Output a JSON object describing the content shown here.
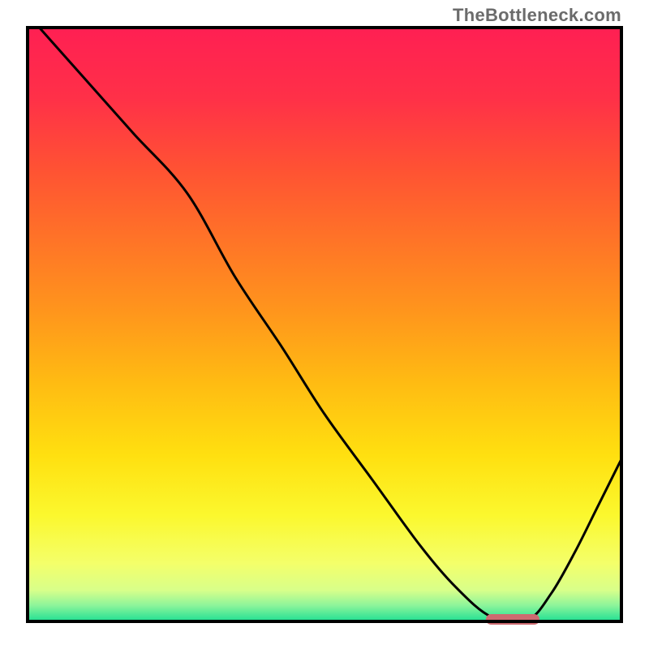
{
  "watermark": "TheBottleneck.com",
  "colors": {
    "gradient_stops": [
      {
        "offset": 0.0,
        "color": "#ff1f53"
      },
      {
        "offset": 0.12,
        "color": "#ff3048"
      },
      {
        "offset": 0.24,
        "color": "#ff5233"
      },
      {
        "offset": 0.36,
        "color": "#ff7427"
      },
      {
        "offset": 0.48,
        "color": "#ff961c"
      },
      {
        "offset": 0.6,
        "color": "#ffbc12"
      },
      {
        "offset": 0.72,
        "color": "#ffe010"
      },
      {
        "offset": 0.82,
        "color": "#fbf82e"
      },
      {
        "offset": 0.9,
        "color": "#f4ff6a"
      },
      {
        "offset": 0.945,
        "color": "#d8ff8a"
      },
      {
        "offset": 0.97,
        "color": "#8ef59a"
      },
      {
        "offset": 0.99,
        "color": "#3de596"
      },
      {
        "offset": 1.0,
        "color": "#16dd8e"
      }
    ],
    "border": "#000000",
    "curve": "#000000",
    "marker": "#cd6a70",
    "watermark_text": "#6b6b6b"
  },
  "chart_data": {
    "type": "line",
    "title": "",
    "xlabel": "",
    "ylabel": "",
    "xlim": [
      0,
      100
    ],
    "ylim": [
      0,
      100
    ],
    "grid": false,
    "x": [
      2,
      10,
      18,
      27,
      35,
      43,
      50,
      58,
      66,
      72,
      78,
      84,
      88,
      92,
      96,
      100
    ],
    "values": [
      100,
      91,
      82,
      72,
      58,
      46,
      35,
      24,
      13,
      6,
      1,
      0.5,
      5,
      12,
      20,
      28
    ],
    "notes": "Single V-shaped curve; y encodes bottleneck percentage (100 worst at top, 0 best at bottom). Background vertical gradient red→yellow→green mirrors quality. Pink marker highlights trough (~x 77–86, y≈0).",
    "marker": {
      "x_start": 77,
      "x_end": 86,
      "y": 0.5
    }
  }
}
